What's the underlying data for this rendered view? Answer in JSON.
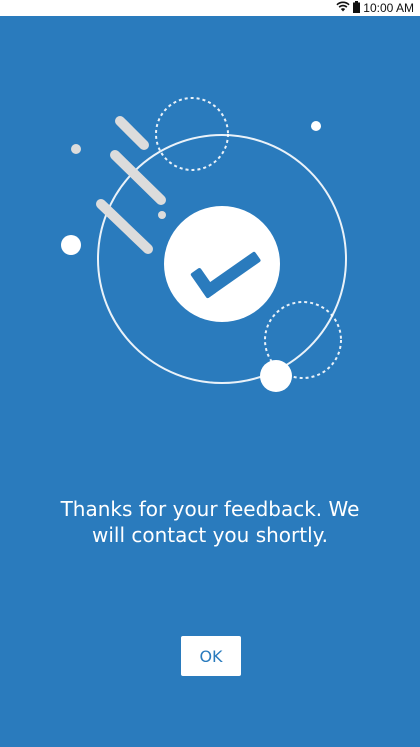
{
  "status_bar": {
    "time": "10:00 AM",
    "icons": [
      "wifi-icon",
      "battery-icon"
    ]
  },
  "dialog": {
    "message_line1": "Thanks for your feedback. We",
    "message_line2": "will contact you shortly.",
    "ok_label": "OK"
  },
  "colors": {
    "background": "#2a7bbd",
    "foreground": "#ffffff",
    "accent_light": "#dcdcdc"
  },
  "illustration_icon": "checkmark-icon"
}
